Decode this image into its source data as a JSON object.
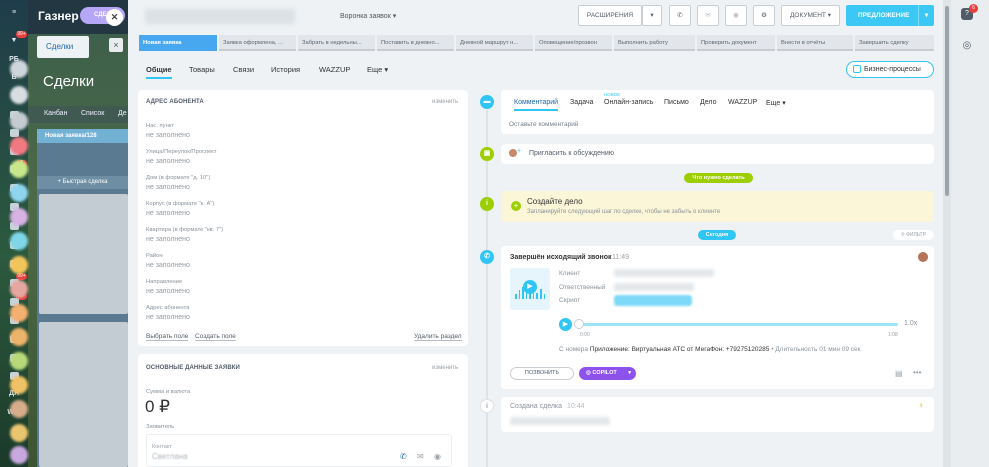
{
  "background": {
    "brand": "Газнер",
    "deal_tab": "СДЕЛКА",
    "deals_tab": "Сделки",
    "page_title": "Сделки",
    "view_switch": [
      "Канбан",
      "Список",
      "Де"
    ],
    "column_title": "Новая заявка",
    "column_count": "/128",
    "quick_add": "+ Быстрая сделка",
    "nav_badges": [
      "99+",
      "7",
      "99+",
      "8"
    ],
    "nav_labels": [
      "РБ",
      "Б",
      "С",
      "ДЯ",
      "WW"
    ]
  },
  "header": {
    "pipeline": "Воронка заявок",
    "extensions": "РАСШИРЕНИЯ",
    "document": "ДОКУМЕНТ",
    "action": "ПРЕДЛОЖЕНИЕ"
  },
  "stages": [
    "Новая заявка",
    "Заявка оформлена, ...",
    "Забрать в недельны...",
    "Поставить в дневно...",
    "Дневной маршрут н...",
    "Оповещение/прозвон",
    "Выполнить работу",
    "Проверить документ",
    "Внести в отчёты",
    "Завершить сделку"
  ],
  "tabs": [
    "Общие",
    "Товары",
    "Связи",
    "История",
    "WAZZUP",
    "Еще"
  ],
  "business_processes": "Бизнес-процессы",
  "address_card": {
    "title": "АДРЕС АБОНЕНТА",
    "edit": "изменить",
    "fields": [
      {
        "label": "Нас. пункт",
        "value": "не заполнено"
      },
      {
        "label": "Улица/Переулок/Проспект",
        "value": "не заполнено"
      },
      {
        "label": "Дом (в формате \"д. 10\")",
        "value": "не заполнено"
      },
      {
        "label": "Корпус (в формате \"к. А\")",
        "value": "не заполнено"
      },
      {
        "label": "Квартира (в формате \"кв. 7\")",
        "value": "не заполнено"
      },
      {
        "label": "Район",
        "value": "не заполнено"
      },
      {
        "label": "Направление",
        "value": "не заполнено"
      },
      {
        "label": "Адрес абонента",
        "value": "не заполнено"
      }
    ],
    "select_field": "Выбрать поле",
    "create_field": "Создать поле",
    "delete_section": "Удалить раздел"
  },
  "main_card": {
    "title": "ОСНОВНЫЕ ДАННЫЕ ЗАЯВКИ",
    "edit": "изменить",
    "sum_label": "Сумма и валюта",
    "sum_value": "0 ₽",
    "applicant_label": "Заявитель",
    "contact_label": "Контакт",
    "contact_name": "Светлана"
  },
  "timeline": {
    "tabs": [
      "Комментарий",
      "Задача",
      "Онлайн-запись",
      "Письмо",
      "Дело",
      "WAZZUP",
      "Еще"
    ],
    "new_badge": "НОВОЕ",
    "comment_placeholder": "Оставьте комментарий",
    "invite": "Пригласить к обсуждению",
    "todo_pill": "Что нужно сделать",
    "create_task_title": "Создайте дело",
    "create_task_hint": "Запланируйте следующий шаг по сделке, чтобы не забыть о клиенте",
    "today_pill": "Сегодня",
    "filter": "ФИЛЬТР",
    "call": {
      "title": "Завершён исходящий звонок",
      "time": "11:49",
      "client_label": "Клиент",
      "responsible_label": "Ответственный",
      "script_label": "Скрипт",
      "audio_start": "0:00",
      "audio_end": "1:08",
      "speed": "1.0x",
      "from_number": "С номера",
      "app_info": "Приложение: Виртуальная АТС от МегаФон: +79275120285",
      "duration": "• Длительность 01 мин 09 сек",
      "call_button": "ПОЗВОНИТЬ",
      "copilot_button": "COPILOT"
    },
    "created": {
      "title": "Создана сделка",
      "time": "10:44"
    }
  },
  "right_badge": "6"
}
